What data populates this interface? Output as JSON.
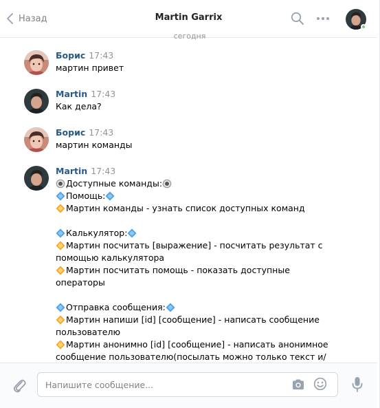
{
  "header": {
    "back_label": "Назад",
    "title": "Martin Garrix"
  },
  "date_separator": "сегодня",
  "messages": [
    {
      "author": "Борис",
      "time": "17:43",
      "lines": [
        "мартин привет"
      ]
    },
    {
      "author": "Martin",
      "time": "17:43",
      "lines": [
        "Как дела?"
      ]
    },
    {
      "author": "Борис",
      "time": "17:43",
      "lines": [
        "мартин команды"
      ]
    },
    {
      "author": "Martin",
      "time": "17:43",
      "lines": [
        "Доступные команды:",
        "Помощь:",
        "Мартин команды - узнать список доступных команд",
        "",
        "Калькулятор:",
        "Мартин посчитать [выражение] - посчитать результат с",
        "помощью калькулятора",
        "Мартин посчитать помощь - показать доступные",
        "операторы",
        "",
        "Отправка сообщения:",
        "Мартин напиши [id] [сообщение] - написать сообщение",
        "пользователю",
        "Мартин анонимно [id] [сообщение] - написать анонимное",
        "сообщение пользователю(посылать можно только текст и/"
      ]
    }
  ],
  "composer": {
    "placeholder": "Напишите сообщение..."
  },
  "colors": {
    "link_blue": "#2a5885",
    "muted_gray": "#939393",
    "online_green": "#8ac176",
    "diamond_blue": "#4a9ee6",
    "diamond_orange": "#f5a623"
  },
  "icons": {
    "back": "chevron-left-icon",
    "search": "search-icon",
    "more": "more-dots-icon",
    "attach": "paperclip-icon",
    "camera": "camera-icon",
    "smile": "smile-icon",
    "mic": "microphone-icon",
    "radio": "radio-button-emoji",
    "blue_diamond": "blue-diamond-emoji",
    "orange_diamond": "orange-diamond-emoji"
  }
}
